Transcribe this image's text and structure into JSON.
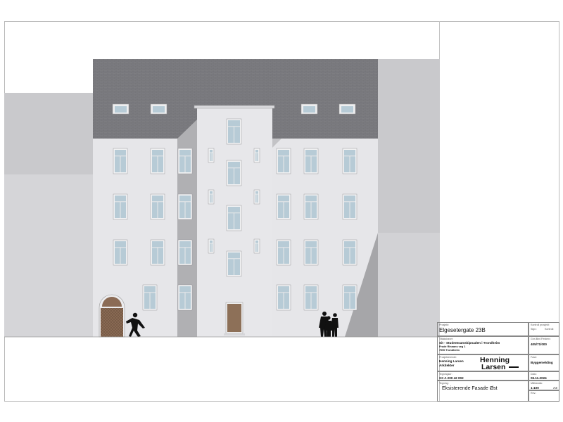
{
  "titleblock": {
    "project_label": "Prosjekt:",
    "project": "Elgesetergate 23B",
    "client_label": "Tiltakshaver:",
    "client": "Sit - Studentsamskipnaden i Trondheim",
    "client_addr1": "Frode Rinnans veg 1",
    "client_addr2": "7050 Trondheim",
    "designer_label": "Prosjekterende:",
    "designer": "Henning Larsen",
    "designer_role": "Arkitekter",
    "drawing_no_label": "Tegningsnr:",
    "drawing_no": "XX A 200 42 002",
    "drawing_label": "Tegning:",
    "drawing_name": "Eksisterende Fasade Øst",
    "control_label": "Kontroll prosjekt:",
    "sign_label": "Sign.:",
    "check_label": "Kontroll:",
    "gnr_label": "Gnr./Bnr./Festenr.:",
    "gnr": "405/71/000",
    "phase_label": "Fase:",
    "phase": "Byggemelding",
    "date_label": "Dato:",
    "date": "06.11.2024",
    "scale_label": "Målestokk:",
    "scale": "1:100",
    "format": "A3",
    "rev_label": "Rev.:",
    "logo_line1": "Henning",
    "logo_line2": "Larsen"
  },
  "colors": {
    "facade": "#e4e4e7",
    "roof": "#7c7c80",
    "neighbor": "#c8c8cb",
    "shadow": "#ababae",
    "window": "#b7cbd6",
    "door": "#8b7059"
  }
}
